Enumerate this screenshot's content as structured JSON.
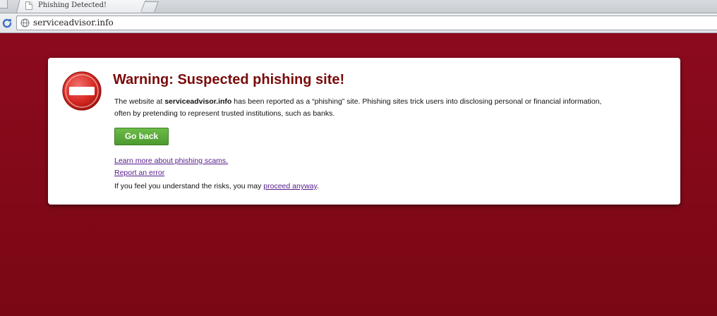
{
  "browser": {
    "tab_title": "Phishing Detected!",
    "tab_close": "×",
    "url": "serviceadvisor.info"
  },
  "warning": {
    "heading": "Warning: Suspected phishing site!",
    "desc_prefix": "The website at ",
    "site_name": "serviceadvisor.info",
    "desc_suffix": " has been reported as a “phishing” site. Phishing sites trick users into disclosing personal or financial information, often by pretending to represent trusted institutions, such as banks.",
    "go_back_label": "Go back",
    "learn_more_label": "Learn more about phishing scams.",
    "report_error_label": "Report an error",
    "proceed_prefix": "If you feel you understand the risks, you may ",
    "proceed_link": "proceed anyway",
    "proceed_suffix": "."
  },
  "colors": {
    "page_background": "#8a0a1c",
    "heading": "#7b0a0a",
    "button_green": "#5aab3a",
    "link_visited": "#551a8b"
  },
  "icons": {
    "stop": "stop-sign-icon",
    "reload": "reload-icon",
    "globe": "globe-icon",
    "page": "page-icon"
  }
}
